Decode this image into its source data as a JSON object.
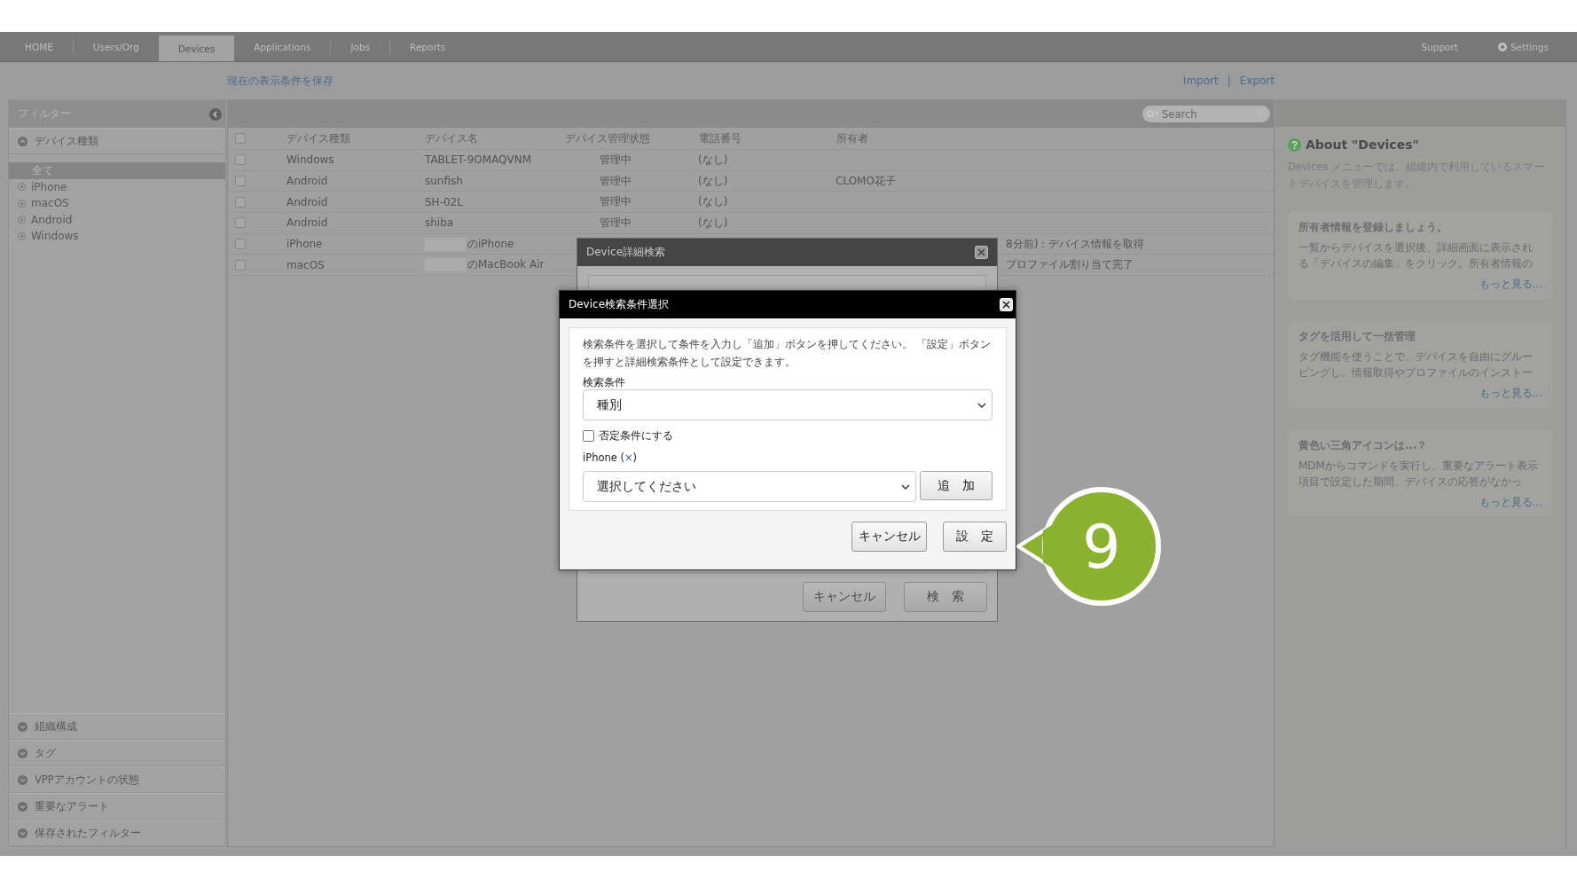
{
  "nav": {
    "tabs": [
      {
        "label": "HOME",
        "selected": false
      },
      {
        "label": "Users/Org",
        "selected": false
      },
      {
        "label": "Devices",
        "selected": true
      },
      {
        "label": "Applications",
        "selected": false
      },
      {
        "label": "Jobs",
        "selected": false
      },
      {
        "label": "Reports",
        "selected": false
      }
    ],
    "support": "Support",
    "settings": "Settings"
  },
  "subbar": {
    "save_link": "現在の表示条件を保存",
    "import": "Import",
    "separator": "|",
    "export": "Export"
  },
  "sidebar": {
    "title": "フィルター",
    "sections": [
      {
        "label": "デバイス種類",
        "expanded": true,
        "items": [
          {
            "label": "全て",
            "selected": true
          },
          {
            "label": "iPhone",
            "selected": false
          },
          {
            "label": "macOS",
            "selected": false
          },
          {
            "label": "Android",
            "selected": false
          },
          {
            "label": "Windows",
            "selected": false
          }
        ]
      },
      {
        "label": "組織構成",
        "expanded": false
      },
      {
        "label": "タグ",
        "expanded": false
      },
      {
        "label": "VPPアカウントの状態",
        "expanded": false
      },
      {
        "label": "重要なアラート",
        "expanded": false
      },
      {
        "label": "保存されたフィルター",
        "expanded": false
      }
    ]
  },
  "table": {
    "search_placeholder": "Search",
    "all_checked": false,
    "columns": [
      "デバイス種類",
      "デバイス名",
      "デバイス管理状態",
      "電話番号",
      "所有者"
    ],
    "rows": [
      {
        "checked": false,
        "type": "Windows",
        "name": "TABLET-9OMAQVNM",
        "name_redacted": false,
        "status": "管理中",
        "phone": "(なし)",
        "owner": "",
        "column_6": ""
      },
      {
        "checked": false,
        "type": "Android",
        "name": "sunfish",
        "name_redacted": false,
        "status": "管理中",
        "phone": "(なし)",
        "owner": "CLOMO花子",
        "column_6": ""
      },
      {
        "checked": false,
        "type": "Android",
        "name": "SH-02L",
        "name_redacted": false,
        "status": "管理中",
        "phone": "(なし)",
        "owner": "",
        "column_6": ""
      },
      {
        "checked": false,
        "type": "Android",
        "name": "shiba",
        "name_redacted": false,
        "status": "管理中",
        "phone": "(なし)",
        "owner": "",
        "column_6": ""
      },
      {
        "checked": false,
        "type": "iPhone",
        "name": "のiPhone",
        "name_redacted": true,
        "status": "",
        "phone": "",
        "owner": "",
        "column_6": "8分前)：デバイス情報を取得"
      },
      {
        "checked": false,
        "type": "macOS",
        "name": "のMacBook Air",
        "name_redacted": true,
        "status": "",
        "phone": "",
        "owner": "",
        "column_6": "プロファイル割り当て完了"
      }
    ]
  },
  "help": {
    "title": "About \"Devices\"",
    "description": "Devices メニューでは、組織内で利用しているスマートデバイスを管理します。",
    "cards": [
      {
        "title": "所有者情報を登録しましょう。",
        "text": "一覧からデバイスを選択後、詳細画面に表示される「デバイスの編集」をクリック。所有者情報の",
        "more": "もっと見る..."
      },
      {
        "title": "タグを活用して一括管理",
        "text": "タグ機能を使うことで、デバイスを自由にグルーピングし、情報取得やプロファイルのインストー",
        "more": "もっと見る..."
      },
      {
        "title": "黄色い三角アイコンは...？",
        "text": "MDMからコマンドを実行し、重要なアラート表示項目で設定した期間、デバイスの応答がなかっ",
        "more": "もっと見る..."
      }
    ]
  },
  "search_dialog": {
    "title": "Device詳細検索",
    "buttons": [
      "キャンセル",
      "検　索"
    ]
  },
  "condition_dialog": {
    "title": "Device検索条件選択",
    "instructions": "検索条件を選択して条件を入力し「追加」ボタンを押してください。 「設定」ボタンを押すと詳細検索条件として設定できます。",
    "condition_label": "検索条件",
    "condition_value": "種別",
    "negate": {
      "label": "否定条件にする",
      "checked": false
    },
    "value_label_before": "iPhone (",
    "value_remove": "×",
    "value_label_after": ")",
    "value_select": "選択してください",
    "add_button": "追　加",
    "buttons": [
      "キャンセル",
      "設　定"
    ]
  },
  "step_number": "9"
}
